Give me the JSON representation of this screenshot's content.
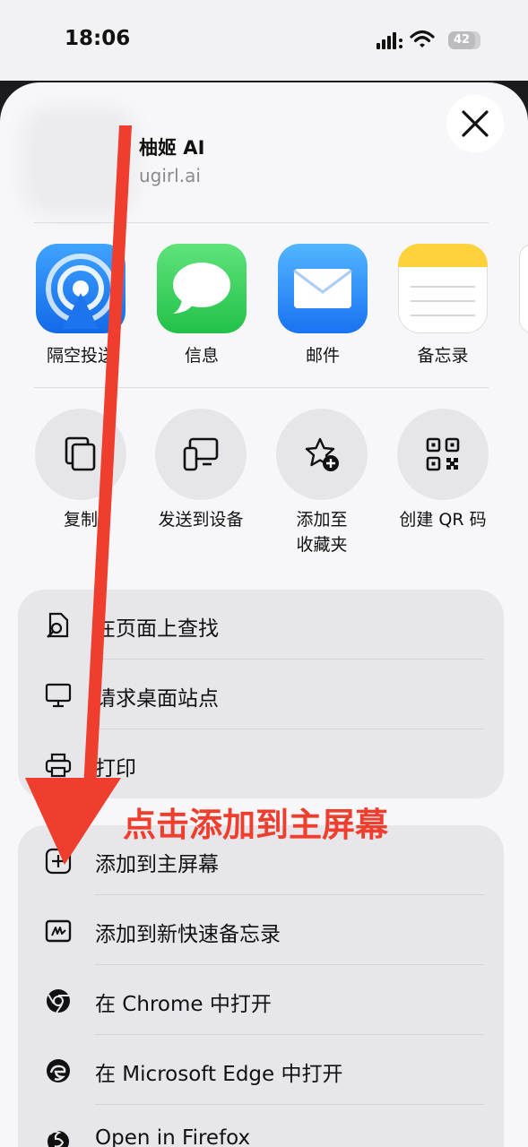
{
  "status_bar": {
    "time": "18:06",
    "battery": "42"
  },
  "header": {
    "title": "柚姬 AI",
    "url": "ugirl.ai"
  },
  "apps": [
    {
      "label": "隔空投送",
      "icon": "airdrop-icon"
    },
    {
      "label": "信息",
      "icon": "messages-icon"
    },
    {
      "label": "邮件",
      "icon": "mail-icon"
    },
    {
      "label": "备忘录",
      "icon": "notes-icon"
    }
  ],
  "actions": [
    {
      "label": "复制",
      "icon": "copy-icon"
    },
    {
      "label": "发送到设备",
      "icon": "send-to-device-icon"
    },
    {
      "label": "添加至\n收藏夹",
      "icon": "add-favorite-icon"
    },
    {
      "label": "创建 QR 码",
      "icon": "qr-code-icon"
    }
  ],
  "menu_group_1": [
    {
      "label": "在页面上查找",
      "icon": "find-in-page-icon"
    },
    {
      "label": "请求桌面站点",
      "icon": "desktop-site-icon"
    },
    {
      "label": "打印",
      "icon": "print-icon"
    }
  ],
  "menu_group_2": [
    {
      "label": "添加到主屏幕",
      "icon": "add-square-icon"
    },
    {
      "label": "添加到新快速备忘录",
      "icon": "quick-note-icon"
    },
    {
      "label": "在 Chrome 中打开",
      "icon": "chrome-icon"
    },
    {
      "label": "在 Microsoft Edge 中打开",
      "icon": "edge-icon"
    },
    {
      "label": "Open in Firefox",
      "icon": "firefox-icon"
    }
  ],
  "annotation": {
    "text": "点击添加到主屏幕",
    "color": "#ef3d2e"
  },
  "colors": {
    "accent_blue": "#2f7cf6",
    "messages_green": "#34c759",
    "arrow_red": "#ef3d2e"
  }
}
